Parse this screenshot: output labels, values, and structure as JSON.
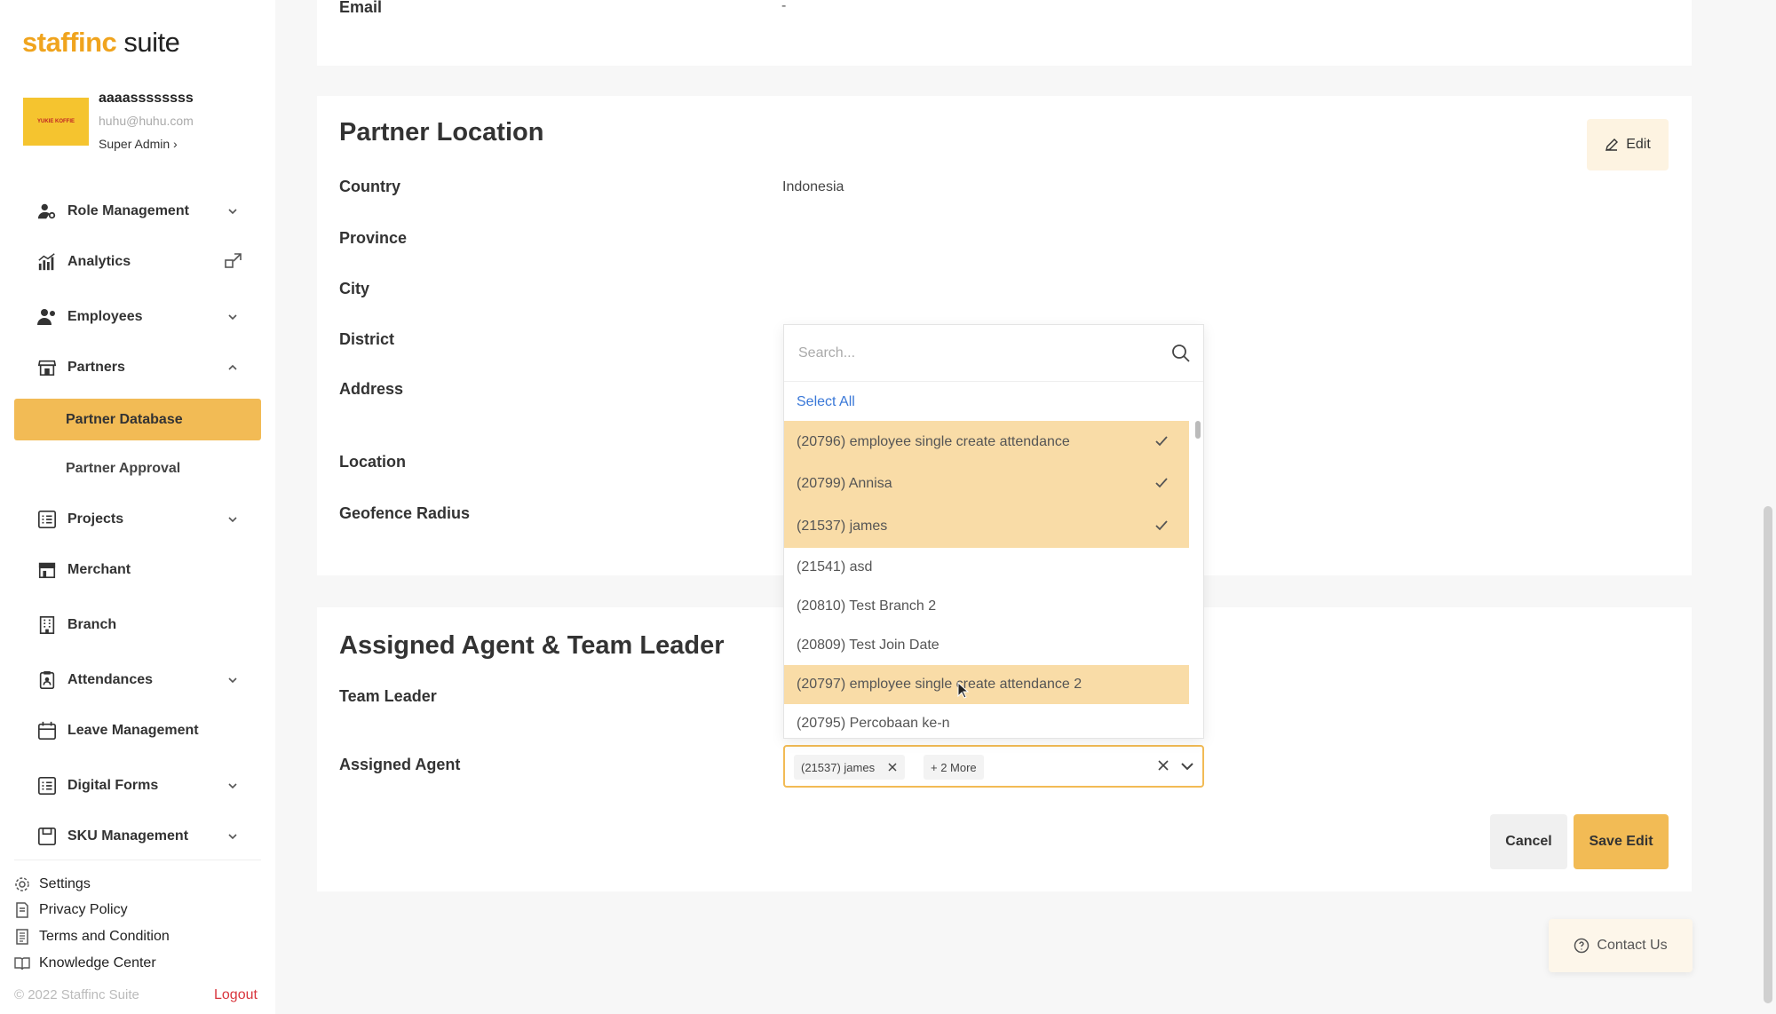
{
  "brand": {
    "part1": "staffinc",
    "part2": " suite"
  },
  "profile": {
    "name": "aaaassssssss",
    "email": "huhu@huhu.com",
    "role": "Super Admin ›",
    "avatar_text": "YUKIE KOFFIE"
  },
  "nav": {
    "role_management": "Role Management",
    "analytics": "Analytics",
    "employees": "Employees",
    "partners": "Partners",
    "partner_database": "Partner Database",
    "partner_approval": "Partner Approval",
    "projects": "Projects",
    "merchant": "Merchant",
    "branch": "Branch",
    "attendances": "Attendances",
    "leave_management": "Leave Management",
    "digital_forms": "Digital Forms",
    "sku_management": "SKU Management"
  },
  "footer": {
    "settings": "Settings",
    "privacy": "Privacy Policy",
    "terms": "Terms and Condition",
    "knowledge": "Knowledge Center",
    "copyright": "© 2022 Staffinc Suite",
    "logout": "Logout"
  },
  "top_card": {
    "email_label": "Email",
    "email_value": "-"
  },
  "location": {
    "title": "Partner Location",
    "edit_label": "Edit",
    "fields": {
      "country_label": "Country",
      "country_value": "Indonesia",
      "province_label": "Province",
      "city_label": "City",
      "district_label": "District",
      "address_label": "Address",
      "location_label": "Location",
      "geofence_label": "Geofence Radius"
    }
  },
  "agents": {
    "title": "Assigned Agent & Team Leader",
    "team_leader_label": "Team Leader",
    "assigned_agent_label": "Assigned Agent",
    "chip_selected": "(21537) james",
    "chip_more": "+ 2 More"
  },
  "dropdown": {
    "search_placeholder": "Search...",
    "select_all": "Select All",
    "items": [
      {
        "label": "(20796) employee single create attendance",
        "selected": true
      },
      {
        "label": "(20799) Annisa",
        "selected": true
      },
      {
        "label": "(21537) james",
        "selected": true
      },
      {
        "label": "(21541) asd",
        "selected": false
      },
      {
        "label": "(20810) Test Branch 2",
        "selected": false
      },
      {
        "label": "(20809) Test Join Date",
        "selected": false
      },
      {
        "label": "(20797) employee single create attendance 2",
        "selected": false,
        "hovered": true
      },
      {
        "label": "(20795) Percobaan ke-n",
        "selected": false
      }
    ]
  },
  "actions": {
    "cancel": "Cancel",
    "save": "Save Edit",
    "contact": "Contact Us"
  },
  "colors": {
    "accent": "#f2bb55",
    "selected_row": "#f9dca7",
    "link": "#3a78d8",
    "logout": "#d9363e"
  }
}
